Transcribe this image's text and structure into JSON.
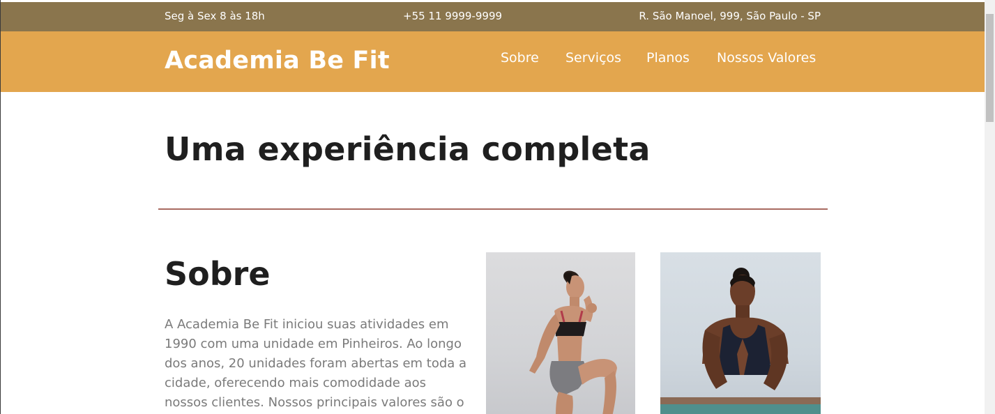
{
  "topbar": {
    "hours": "Seg à Sex 8 às 18h",
    "phone": "+55 11 9999-9999",
    "address": "R. São Manoel, 999, São Paulo - SP"
  },
  "header": {
    "logo": "Academia Be Fit",
    "nav": [
      "Sobre",
      "Serviços",
      "Planos",
      "Nossos Valores"
    ]
  },
  "hero": {
    "title": "Uma experiência completa"
  },
  "about": {
    "title": "Sobre",
    "text": "A Academia Be Fit iniciou suas atividades em 1990 com uma unidade em Pinheiros. Ao longo dos anos, 20 unidades foram abertas em toda a cidade, oferecendo mais comodidade aos nossos clientes. Nossos principais valores são o bem-"
  },
  "images": [
    "woman-exercising-photo",
    "woman-meditating-photo"
  ],
  "colors": {
    "topbar_bg": "#8a754d",
    "header_bg": "#e3a64e",
    "divider": "#a86a60",
    "title_text": "#1f1f1f",
    "body_text": "#7a7a7a"
  }
}
